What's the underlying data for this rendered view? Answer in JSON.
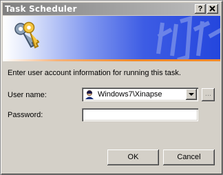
{
  "window": {
    "title": "Task Scheduler",
    "help_label": "?",
    "close_label": "x"
  },
  "banner": {
    "icon": "keys-icon",
    "watermark": "task-scheduler-watermark"
  },
  "form": {
    "instruction": "Enter user account information for running this task.",
    "username_label": "User name:",
    "username_value": "Windows7\\Xinapse",
    "browse_label": "...",
    "password_label": "Password:",
    "password_value": ""
  },
  "buttons": {
    "ok": "OK",
    "cancel": "Cancel"
  }
}
